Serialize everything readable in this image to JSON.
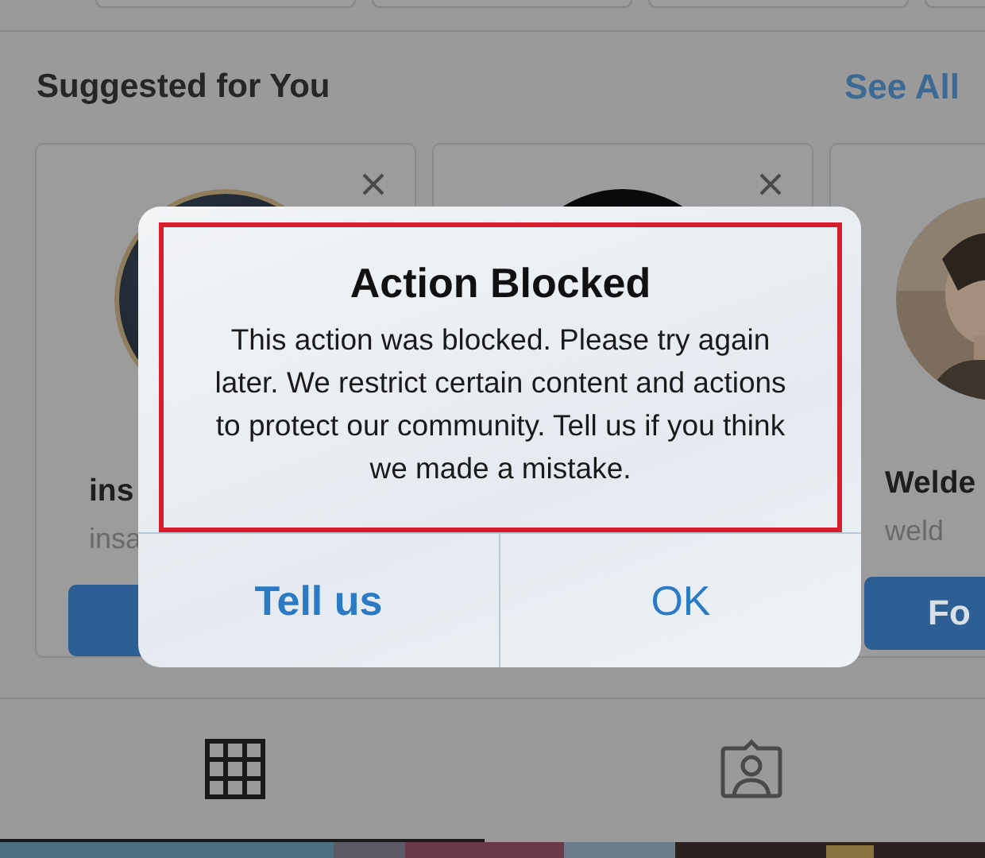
{
  "header": {
    "title": "Suggested for You",
    "link": "See All"
  },
  "cards": [
    {
      "kind": "dark",
      "name": "ins",
      "username": "insa",
      "follow_button": true
    },
    {
      "kind": "black"
    },
    {
      "kind": "picture",
      "name": "Welde",
      "username": "weld",
      "follow_button": true,
      "button_label": "Fo"
    }
  ],
  "tabs": [
    {
      "kind": "grid",
      "selected": true
    },
    {
      "kind": "tagged",
      "selected": false
    }
  ],
  "dialog": {
    "title": "Action Blocked",
    "message": "This action was blocked. Please try again later. We restrict certain content and actions to protect our community. Tell us if you think we made a mistake.",
    "highlighted": true,
    "buttons": [
      {
        "label": "Tell us",
        "kind": "primary"
      },
      {
        "label": "OK",
        "kind": "default"
      }
    ]
  }
}
